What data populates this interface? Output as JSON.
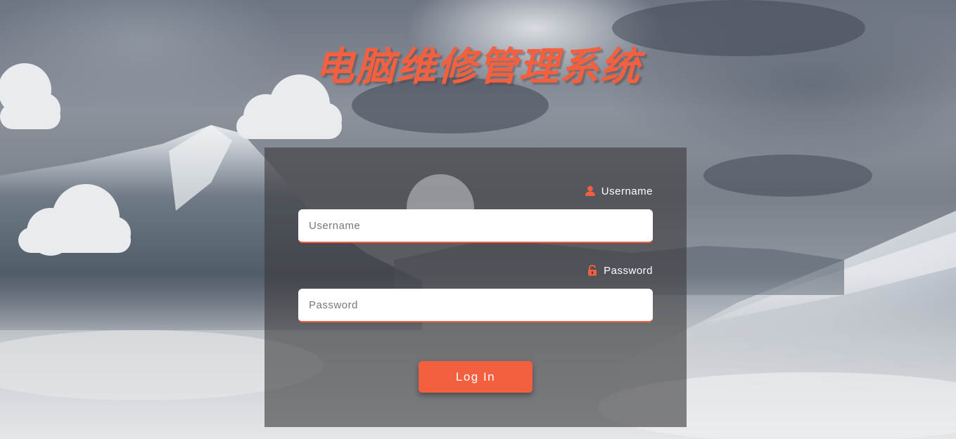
{
  "page": {
    "title": "电脑维修管理系统"
  },
  "login_form": {
    "username_label": "Username",
    "username_placeholder": "Username",
    "username_value": "",
    "username_icon": "user-icon",
    "password_label": "Password",
    "password_placeholder": "Password",
    "password_value": "",
    "password_icon": "unlock-icon",
    "submit_label": "Log In"
  },
  "colors": {
    "accent": "#f2603f",
    "panel": "rgba(60,60,62,0.62)",
    "label_text": "#ffffff"
  }
}
